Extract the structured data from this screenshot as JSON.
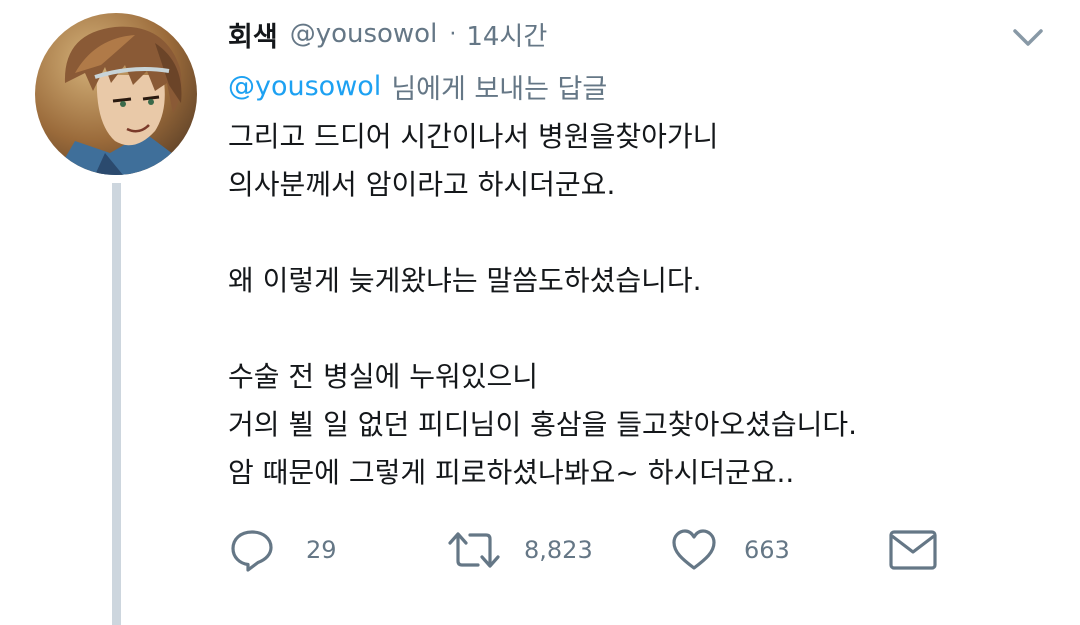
{
  "author": {
    "display_name": "회색",
    "handle": "@yousowol",
    "separator": "·",
    "time": "14시간"
  },
  "reply_to": {
    "mention": "@yousowol",
    "suffix": "님에게 보내는 답글"
  },
  "tweet": {
    "lines": [
      "그리고 드디어 시간이나서 병원을찾아가니",
      "의사분께서 암이라고 하시더군요.",
      "",
      "왜 이렇게 늦게왔냐는 말씀도하셨습니다.",
      "",
      "수술 전 병실에 누워있으니",
      "거의 뵐 일 없던 피디님이 홍삼을 들고찾아오셨습니다.",
      "암 때문에 그렇게 피로하셨나봐요~ 하시더군요.."
    ]
  },
  "actions": {
    "reply": {
      "icon": "reply-icon",
      "count": "29"
    },
    "retweet": {
      "icon": "retweet-icon",
      "count": "8,823"
    },
    "like": {
      "icon": "heart-icon",
      "count": "663"
    },
    "dm": {
      "icon": "envelope-icon"
    }
  },
  "colors": {
    "text": "#14171a",
    "secondary": "#657786",
    "link": "#1da1f2",
    "thread_line": "#cdd6de"
  }
}
